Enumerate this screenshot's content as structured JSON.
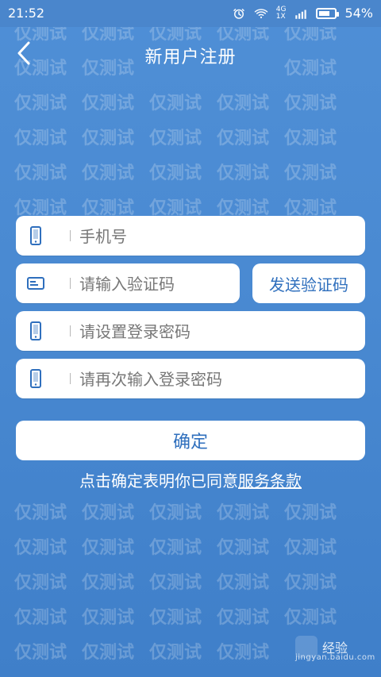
{
  "status_bar": {
    "time": "21:52",
    "network_label_top": "4G",
    "network_label_bottom": "1X",
    "battery_percent": "54%"
  },
  "nav": {
    "title": "新用户注册"
  },
  "form": {
    "phone_placeholder": "手机号",
    "code_placeholder": "请输入验证码",
    "send_code_label": "发送验证码",
    "password_placeholder": "请设置登录密码",
    "password_confirm_placeholder": "请再次输入登录密码",
    "confirm_label": "确定",
    "agreement_prefix": "点击确定表明你已同意",
    "agreement_link": "服务条款"
  },
  "watermark": {
    "text": "仅测试"
  },
  "footer": {
    "brand_cn": "经验",
    "brand_url": "jingyan.baidu.com"
  },
  "colors": {
    "background": "#4f8fd6",
    "card": "#ffffff",
    "accent_text": "#2f6fbd"
  }
}
